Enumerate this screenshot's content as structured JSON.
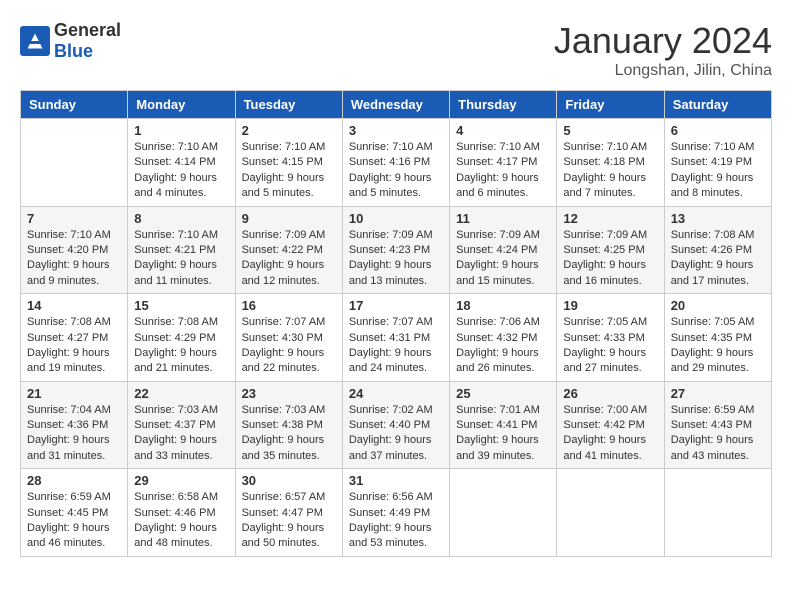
{
  "header": {
    "logo": {
      "general": "General",
      "blue": "Blue"
    },
    "title": "January 2024",
    "location": "Longshan, Jilin, China"
  },
  "calendar": {
    "days_of_week": [
      "Sunday",
      "Monday",
      "Tuesday",
      "Wednesday",
      "Thursday",
      "Friday",
      "Saturday"
    ],
    "weeks": [
      [
        {
          "day": "",
          "info": ""
        },
        {
          "day": "1",
          "info": "Sunrise: 7:10 AM\nSunset: 4:14 PM\nDaylight: 9 hours\nand 4 minutes."
        },
        {
          "day": "2",
          "info": "Sunrise: 7:10 AM\nSunset: 4:15 PM\nDaylight: 9 hours\nand 5 minutes."
        },
        {
          "day": "3",
          "info": "Sunrise: 7:10 AM\nSunset: 4:16 PM\nDaylight: 9 hours\nand 5 minutes."
        },
        {
          "day": "4",
          "info": "Sunrise: 7:10 AM\nSunset: 4:17 PM\nDaylight: 9 hours\nand 6 minutes."
        },
        {
          "day": "5",
          "info": "Sunrise: 7:10 AM\nSunset: 4:18 PM\nDaylight: 9 hours\nand 7 minutes."
        },
        {
          "day": "6",
          "info": "Sunrise: 7:10 AM\nSunset: 4:19 PM\nDaylight: 9 hours\nand 8 minutes."
        }
      ],
      [
        {
          "day": "7",
          "info": "Sunrise: 7:10 AM\nSunset: 4:20 PM\nDaylight: 9 hours\nand 9 minutes."
        },
        {
          "day": "8",
          "info": "Sunrise: 7:10 AM\nSunset: 4:21 PM\nDaylight: 9 hours\nand 11 minutes."
        },
        {
          "day": "9",
          "info": "Sunrise: 7:09 AM\nSunset: 4:22 PM\nDaylight: 9 hours\nand 12 minutes."
        },
        {
          "day": "10",
          "info": "Sunrise: 7:09 AM\nSunset: 4:23 PM\nDaylight: 9 hours\nand 13 minutes."
        },
        {
          "day": "11",
          "info": "Sunrise: 7:09 AM\nSunset: 4:24 PM\nDaylight: 9 hours\nand 15 minutes."
        },
        {
          "day": "12",
          "info": "Sunrise: 7:09 AM\nSunset: 4:25 PM\nDaylight: 9 hours\nand 16 minutes."
        },
        {
          "day": "13",
          "info": "Sunrise: 7:08 AM\nSunset: 4:26 PM\nDaylight: 9 hours\nand 17 minutes."
        }
      ],
      [
        {
          "day": "14",
          "info": "Sunrise: 7:08 AM\nSunset: 4:27 PM\nDaylight: 9 hours\nand 19 minutes."
        },
        {
          "day": "15",
          "info": "Sunrise: 7:08 AM\nSunset: 4:29 PM\nDaylight: 9 hours\nand 21 minutes."
        },
        {
          "day": "16",
          "info": "Sunrise: 7:07 AM\nSunset: 4:30 PM\nDaylight: 9 hours\nand 22 minutes."
        },
        {
          "day": "17",
          "info": "Sunrise: 7:07 AM\nSunset: 4:31 PM\nDaylight: 9 hours\nand 24 minutes."
        },
        {
          "day": "18",
          "info": "Sunrise: 7:06 AM\nSunset: 4:32 PM\nDaylight: 9 hours\nand 26 minutes."
        },
        {
          "day": "19",
          "info": "Sunrise: 7:05 AM\nSunset: 4:33 PM\nDaylight: 9 hours\nand 27 minutes."
        },
        {
          "day": "20",
          "info": "Sunrise: 7:05 AM\nSunset: 4:35 PM\nDaylight: 9 hours\nand 29 minutes."
        }
      ],
      [
        {
          "day": "21",
          "info": "Sunrise: 7:04 AM\nSunset: 4:36 PM\nDaylight: 9 hours\nand 31 minutes."
        },
        {
          "day": "22",
          "info": "Sunrise: 7:03 AM\nSunset: 4:37 PM\nDaylight: 9 hours\nand 33 minutes."
        },
        {
          "day": "23",
          "info": "Sunrise: 7:03 AM\nSunset: 4:38 PM\nDaylight: 9 hours\nand 35 minutes."
        },
        {
          "day": "24",
          "info": "Sunrise: 7:02 AM\nSunset: 4:40 PM\nDaylight: 9 hours\nand 37 minutes."
        },
        {
          "day": "25",
          "info": "Sunrise: 7:01 AM\nSunset: 4:41 PM\nDaylight: 9 hours\nand 39 minutes."
        },
        {
          "day": "26",
          "info": "Sunrise: 7:00 AM\nSunset: 4:42 PM\nDaylight: 9 hours\nand 41 minutes."
        },
        {
          "day": "27",
          "info": "Sunrise: 6:59 AM\nSunset: 4:43 PM\nDaylight: 9 hours\nand 43 minutes."
        }
      ],
      [
        {
          "day": "28",
          "info": "Sunrise: 6:59 AM\nSunset: 4:45 PM\nDaylight: 9 hours\nand 46 minutes."
        },
        {
          "day": "29",
          "info": "Sunrise: 6:58 AM\nSunset: 4:46 PM\nDaylight: 9 hours\nand 48 minutes."
        },
        {
          "day": "30",
          "info": "Sunrise: 6:57 AM\nSunset: 4:47 PM\nDaylight: 9 hours\nand 50 minutes."
        },
        {
          "day": "31",
          "info": "Sunrise: 6:56 AM\nSunset: 4:49 PM\nDaylight: 9 hours\nand 53 minutes."
        },
        {
          "day": "",
          "info": ""
        },
        {
          "day": "",
          "info": ""
        },
        {
          "day": "",
          "info": ""
        }
      ]
    ]
  }
}
